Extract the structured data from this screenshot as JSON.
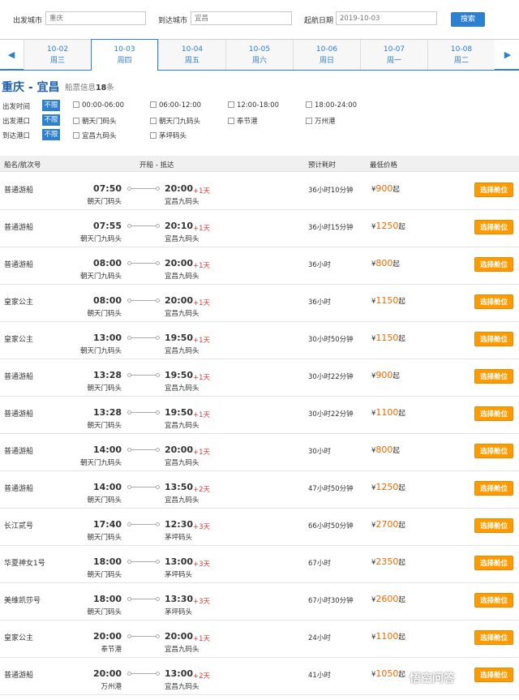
{
  "search": {
    "from_label": "出发城市",
    "from_value": "重庆",
    "to_label": "到达城市",
    "to_value": "宜昌",
    "date_label": "起航日期",
    "date_value": "2019-10-03",
    "button": "搜索"
  },
  "dates": [
    {
      "date": "10-02",
      "weekday": "周三"
    },
    {
      "date": "10-03",
      "weekday": "周四"
    },
    {
      "date": "10-04",
      "weekday": "周五"
    },
    {
      "date": "10-05",
      "weekday": "周六"
    },
    {
      "date": "10-06",
      "weekday": "周日"
    },
    {
      "date": "10-07",
      "weekday": "周一"
    },
    {
      "date": "10-08",
      "weekday": "周二"
    }
  ],
  "route": {
    "title": "重庆 - 宜昌",
    "info_prefix": "船票信息",
    "count": "18",
    "info_suffix": "条"
  },
  "filters": {
    "all_label": "不限",
    "departure_time": {
      "label": "出发时间",
      "options": [
        "00:00-06:00",
        "06:00-12:00",
        "12:00-18:00",
        "18:00-24:00"
      ]
    },
    "departure_port": {
      "label": "出发港口",
      "options": [
        "朝天门码头",
        "朝天门九码头",
        "奉节港",
        "万州港"
      ]
    },
    "arrival_port": {
      "label": "到达港口",
      "options": [
        "宜昌九码头",
        "茅坪码头"
      ]
    }
  },
  "table": {
    "headers": {
      "ship": "船名/航次号",
      "time": "开船 - 抵达",
      "duration": "预计耗时",
      "price": "最低价格"
    },
    "rows": [
      {
        "ship": "普通游船",
        "dep_time": "07:50",
        "dep_port": "朝天门码头",
        "arr_time": "20:00",
        "plus": "+1天",
        "arr_port": "宜昌九码头",
        "duration": "36小时10分钟",
        "price": "900"
      },
      {
        "ship": "普通游船",
        "dep_time": "07:55",
        "dep_port": "朝天门九码头",
        "arr_time": "20:10",
        "plus": "+1天",
        "arr_port": "宜昌九码头",
        "duration": "36小时15分钟",
        "price": "1250"
      },
      {
        "ship": "普通游船",
        "dep_time": "08:00",
        "dep_port": "朝天门九码头",
        "arr_time": "20:00",
        "plus": "+1天",
        "arr_port": "宜昌九码头",
        "duration": "36小时",
        "price": "800"
      },
      {
        "ship": "皇家公主",
        "dep_time": "08:00",
        "dep_port": "朝天门码头",
        "arr_time": "20:00",
        "plus": "+1天",
        "arr_port": "宜昌九码头",
        "duration": "36小时",
        "price": "1150"
      },
      {
        "ship": "皇家公主",
        "dep_time": "13:00",
        "dep_port": "朝天门九码头",
        "arr_time": "19:50",
        "plus": "+1天",
        "arr_port": "宜昌九码头",
        "duration": "30小时50分钟",
        "price": "1150"
      },
      {
        "ship": "普通游船",
        "dep_time": "13:28",
        "dep_port": "朝天门码头",
        "arr_time": "19:50",
        "plus": "+1天",
        "arr_port": "宜昌九码头",
        "duration": "30小时22分钟",
        "price": "900"
      },
      {
        "ship": "普通游船",
        "dep_time": "13:28",
        "dep_port": "朝天门码头",
        "arr_time": "19:50",
        "plus": "+1天",
        "arr_port": "宜昌九码头",
        "duration": "30小时22分钟",
        "price": "1100"
      },
      {
        "ship": "普通游船",
        "dep_time": "14:00",
        "dep_port": "朝天门九码头",
        "arr_time": "20:00",
        "plus": "+1天",
        "arr_port": "宜昌九码头",
        "duration": "30小时",
        "price": "800"
      },
      {
        "ship": "普通游船",
        "dep_time": "14:00",
        "dep_port": "朝天门码头",
        "arr_time": "13:50",
        "plus": "+2天",
        "arr_port": "宜昌九码头",
        "duration": "47小时50分钟",
        "price": "1250"
      },
      {
        "ship": "长江贰号",
        "dep_time": "17:40",
        "dep_port": "朝天门码头",
        "arr_time": "12:30",
        "plus": "+3天",
        "arr_port": "茅坪码头",
        "duration": "66小时50分钟",
        "price": "2700"
      },
      {
        "ship": "华夏神女1号",
        "dep_time": "18:00",
        "dep_port": "朝天门码头",
        "arr_time": "13:00",
        "plus": "+3天",
        "arr_port": "茅坪码头",
        "duration": "67小时",
        "price": "2350"
      },
      {
        "ship": "美维凯莎号",
        "dep_time": "18:00",
        "dep_port": "朝天门码头",
        "arr_time": "13:30",
        "plus": "+3天",
        "arr_port": "茅坪码头",
        "duration": "67小时30分钟",
        "price": "2600"
      },
      {
        "ship": "皇家公主",
        "dep_time": "20:00",
        "dep_port": "奉节港",
        "arr_time": "20:00",
        "plus": "+1天",
        "arr_port": "宜昌九码头",
        "duration": "24小时",
        "price": "1100"
      },
      {
        "ship": "普通游船",
        "dep_time": "20:00",
        "dep_port": "万州港",
        "arr_time": "13:00",
        "plus": "+2天",
        "arr_port": "宜昌九码头",
        "duration": "41小时",
        "price": "1050"
      }
    ],
    "currency": "¥",
    "price_suffix": "起",
    "select_button": "选择舱位"
  },
  "watermark": "悟空问答"
}
